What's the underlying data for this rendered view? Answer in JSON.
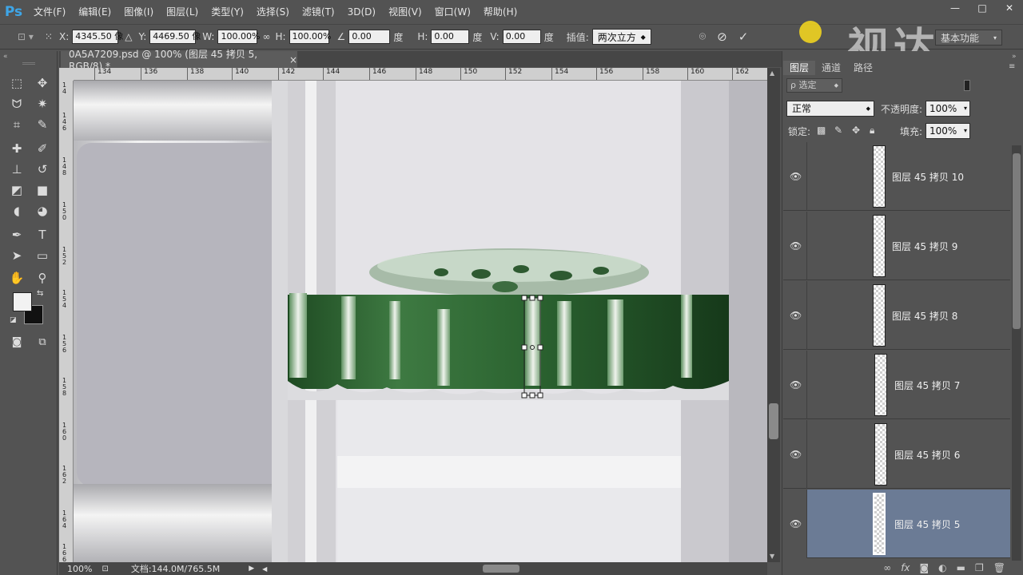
{
  "app": {
    "logo": "Ps",
    "menu": [
      "文件(F)",
      "编辑(E)",
      "图像(I)",
      "图层(L)",
      "类型(Y)",
      "选择(S)",
      "滤镜(T)",
      "3D(D)",
      "视图(V)",
      "窗口(W)",
      "帮助(H)"
    ],
    "window_controls": [
      "—",
      "□",
      "✕"
    ],
    "workspace": "基本功能",
    "watermark": "视达"
  },
  "options_bar": {
    "x_label": "X:",
    "x_value": "4345.50 像",
    "y_label": "Y:",
    "y_value": "4469.50 像",
    "w_label": "W:",
    "w_value": "100.00%",
    "h_label": "H:",
    "h_value": "100.00%",
    "angle_value": "0.00",
    "angle_unit": "度",
    "hskew_label": "H:",
    "hskew_value": "0.00",
    "hskew_unit": "度",
    "vskew_label": "V:",
    "vskew_value": "0.00",
    "vskew_unit": "度",
    "interp_label": "插值:",
    "interp_value": "两次立方"
  },
  "document": {
    "tab_title": "0A5A7209.psd @ 100% (图层 45 拷贝 5, RGB/8) *",
    "close": "×",
    "ruler_h": [
      "134",
      "136",
      "138",
      "140",
      "142",
      "144",
      "146",
      "148",
      "150",
      "152",
      "154",
      "156",
      "158",
      "160",
      "162"
    ],
    "ruler_v": [
      "1 4",
      "1 4 6",
      "1 4 8",
      "1 5 0",
      "1 5 2",
      "1 5 4",
      "1 5 6",
      "1 5 8",
      "1 6 0",
      "1 6 2",
      "1 6 4",
      "1 6 6"
    ],
    "zoom": "100%",
    "doc_size": "文档:144.0M/765.5M"
  },
  "layers_panel": {
    "tabs": [
      "图层",
      "通道",
      "路径"
    ],
    "filter_label": "ρ 选定",
    "blend_mode": "正常",
    "opacity_label": "不透明度:",
    "opacity_value": "100%",
    "lock_label": "锁定:",
    "fill_label": "填充:",
    "fill_value": "100%",
    "layers": [
      {
        "name": "图层 45 拷贝 10",
        "selected": false
      },
      {
        "name": "图层 45 拷贝 9",
        "selected": false
      },
      {
        "name": "图层 45 拷贝 8",
        "selected": false
      },
      {
        "name": "图层 45 拷贝 7",
        "selected": false
      },
      {
        "name": "图层 45 拷贝 6",
        "selected": false
      },
      {
        "name": "图层 45 拷贝 5",
        "selected": true
      }
    ],
    "footer_icons": [
      "link-icon",
      "fx-icon",
      "mask-icon",
      "adjustment-icon",
      "folder-icon",
      "new-layer-icon",
      "trash-icon"
    ]
  },
  "colors": {
    "accent_selected": "#6b7b95",
    "ps_blue": "#3ea6e8",
    "glass_green": "#2f6b34"
  }
}
